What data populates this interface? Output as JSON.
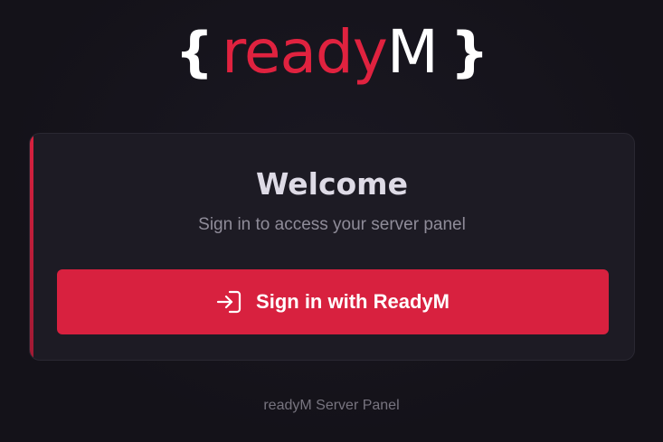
{
  "logo": {
    "brace_open": "{",
    "word_red": "ready",
    "word_white": "M",
    "brace_close": "}",
    "red_color": "#e0223f"
  },
  "card": {
    "title": "Welcome",
    "subtitle": "Sign in to access your server panel",
    "signin_button_label": "Sign in with ReadyM",
    "signin_icon": "login-arrow-icon",
    "accent_color": "#d8213f"
  },
  "footer": {
    "text": "readyM Server Panel"
  }
}
